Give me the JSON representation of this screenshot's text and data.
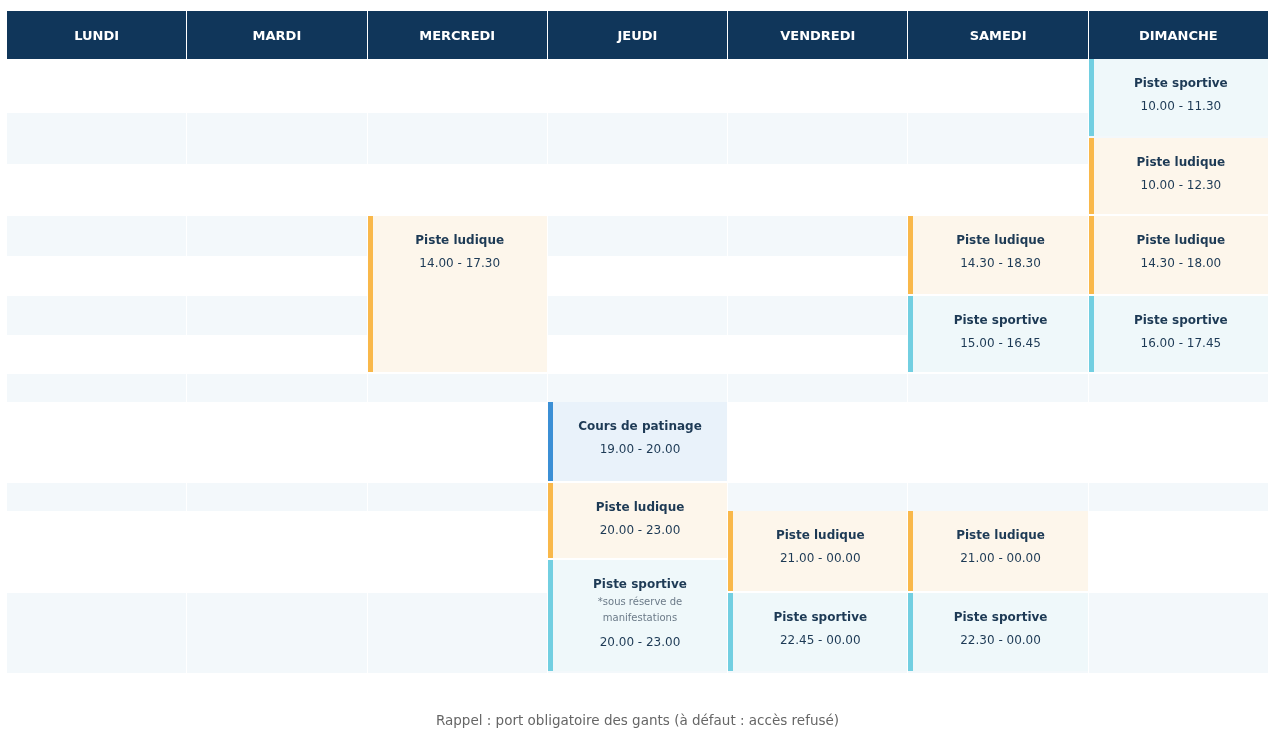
{
  "days": [
    {
      "label": "LUNDI"
    },
    {
      "label": "MARDI"
    },
    {
      "label": "MERCREDI",
      "events": [
        {
          "kind": "ludique",
          "title": "Piste ludique",
          "time": "14.00 - 17.30"
        }
      ]
    },
    {
      "label": "JEUDI",
      "events": [
        {
          "kind": "cours",
          "title": "Cours de patinage",
          "time": "19.00 - 20.00"
        },
        {
          "kind": "ludique",
          "title": "Piste ludique",
          "time": "20.00 - 23.00"
        },
        {
          "kind": "sportive",
          "title": "Piste sportive",
          "note": "*sous réserve de manifestations",
          "time": "20.00 - 23.00"
        }
      ]
    },
    {
      "label": "VENDREDI",
      "events": [
        {
          "kind": "ludique",
          "title": "Piste ludique",
          "time": "21.00 - 00.00"
        },
        {
          "kind": "sportive",
          "title": "Piste sportive",
          "time": "22.45 - 00.00"
        }
      ]
    },
    {
      "label": "SAMEDI",
      "events": [
        {
          "kind": "ludique",
          "title": "Piste ludique",
          "time": "14.30 - 18.30"
        },
        {
          "kind": "sportive",
          "title": "Piste sportive",
          "time": "15.00 - 16.45"
        },
        {
          "kind": "ludique",
          "title": "Piste ludique",
          "time": "21.00 - 00.00"
        },
        {
          "kind": "sportive",
          "title": "Piste sportive",
          "time": "22.30 - 00.00"
        }
      ]
    },
    {
      "label": "DIMANCHE",
      "events": [
        {
          "kind": "sportive",
          "title": "Piste sportive",
          "time": "10.00 - 11.30"
        },
        {
          "kind": "ludique",
          "title": "Piste ludique",
          "time": "10.00 - 12.30"
        },
        {
          "kind": "ludique",
          "title": "Piste ludique",
          "time": "14.30 - 18.00"
        },
        {
          "kind": "sportive",
          "title": "Piste sportive",
          "time": "16.00 - 17.45"
        }
      ]
    }
  ],
  "footnote": "Rappel : port obligatoire des gants (à défaut : accès refusé)"
}
